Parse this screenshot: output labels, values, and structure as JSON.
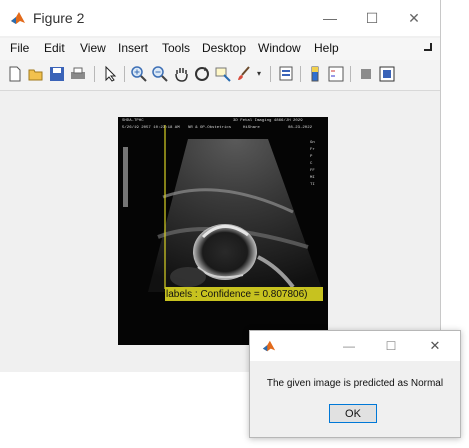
{
  "window": {
    "title": "Figure 2",
    "controls": [
      "—",
      "☐",
      "✕"
    ]
  },
  "menubar": [
    "File",
    "Edit",
    "View",
    "Insert",
    "Tools",
    "Desktop",
    "Window",
    "Help"
  ],
  "toolbar": {
    "icons": [
      "new-figure-icon",
      "open-file-icon",
      "save-icon",
      "print-icon",
      "select-cursor-icon",
      "zoom-in-icon",
      "zoom-out-icon",
      "pan-hand-icon",
      "rotate-3d-icon",
      "data-cursor-icon",
      "brush-icon",
      "link-plot-icon",
      "colorbar-icon",
      "legend-icon",
      "hide-plot-tools-icon",
      "show-plot-tools-icon"
    ]
  },
  "image": {
    "header_left_1": "SHDA-TPHC",
    "header_left_2": "5/26/19 2057 10:23:18 AM",
    "header_center_1": "NR & OP-Obstetrics",
    "header_center_2": "HiShare",
    "header_right_1": "3D Fetal Imaging 4866/JH 2029",
    "header_right_2": "08-23-2022",
    "side_labels": [
      "Gn",
      "Fr",
      "P",
      "C",
      "FF",
      "MI",
      "TI"
    ],
    "overlay_label": "labels : Confidence = 0.807806)"
  },
  "dialog": {
    "title_controls": [
      "—",
      "☐",
      "✕"
    ],
    "message": "The given image is predicted as Normal",
    "ok_label": "OK"
  },
  "colors": {
    "label_bar": "#c7c21f",
    "crosshair": "#d9d224",
    "window_bg": "#f0f0f0",
    "ok_border": "#0078d7"
  }
}
